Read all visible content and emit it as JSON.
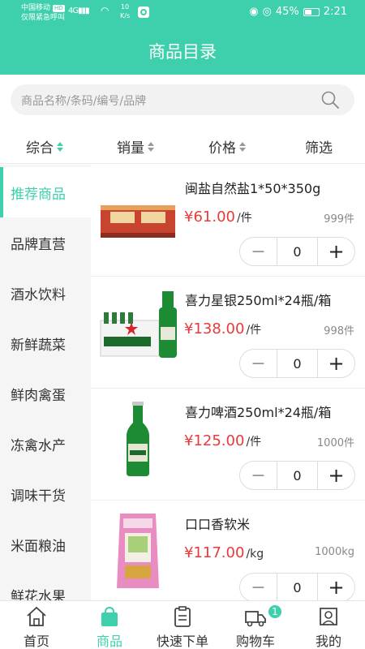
{
  "status_bar": {
    "carrier": "中国移动",
    "carrier_badge": "HD",
    "emergency": "仅限紧急呼叫",
    "signal": "4G",
    "speed_value": "10",
    "speed_unit": "K/s",
    "battery": "45%",
    "time": "2:21"
  },
  "header": {
    "title": "商品目录"
  },
  "search": {
    "placeholder": "商品名称/条码/编号/品牌"
  },
  "sort_bar": {
    "items": [
      {
        "label": "综合",
        "active": true
      },
      {
        "label": "销量",
        "active": false
      },
      {
        "label": "价格",
        "active": false
      }
    ],
    "filter": "筛选"
  },
  "sidebar": {
    "items": [
      {
        "label": "推荐商品",
        "active": true
      },
      {
        "label": "品牌直营"
      },
      {
        "label": "酒水饮料"
      },
      {
        "label": "新鲜蔬菜"
      },
      {
        "label": "鲜肉禽蛋"
      },
      {
        "label": "冻禽水产"
      },
      {
        "label": "调味干货"
      },
      {
        "label": "米面粮油"
      },
      {
        "label": "鲜花水果"
      }
    ]
  },
  "products": [
    {
      "name": "闽盐自然盐1*50*350g",
      "price": "¥61.00",
      "unit": "/件",
      "stock": "999件",
      "qty": "0",
      "image": "salt-box-image"
    },
    {
      "name": "喜力星银250ml*24瓶/箱",
      "price": "¥138.00",
      "unit": "/件",
      "stock": "998件",
      "qty": "0",
      "image": "heineken-silver-case-image"
    },
    {
      "name": "喜力啤酒250ml*24瓶/箱",
      "price": "¥125.00",
      "unit": "/件",
      "stock": "1000件",
      "qty": "0",
      "image": "heineken-bottle-image"
    },
    {
      "name": "口口香软米",
      "price": "¥117.00",
      "unit": "/kg",
      "stock": "1000kg",
      "qty": "0",
      "image": "rice-bag-image"
    }
  ],
  "stepper": {
    "minus": "−",
    "plus": "+"
  },
  "tab_bar": {
    "items": [
      {
        "label": "首页",
        "icon": "home-icon"
      },
      {
        "label": "商品",
        "icon": "shopping-bag-icon",
        "active": true
      },
      {
        "label": "快速下单",
        "icon": "clipboard-icon"
      },
      {
        "label": "购物车",
        "icon": "truck-cart-icon",
        "badge": "1"
      },
      {
        "label": "我的",
        "icon": "profile-icon"
      }
    ]
  },
  "colors": {
    "brand": "#3ed0ac",
    "price": "#e83a3a"
  }
}
